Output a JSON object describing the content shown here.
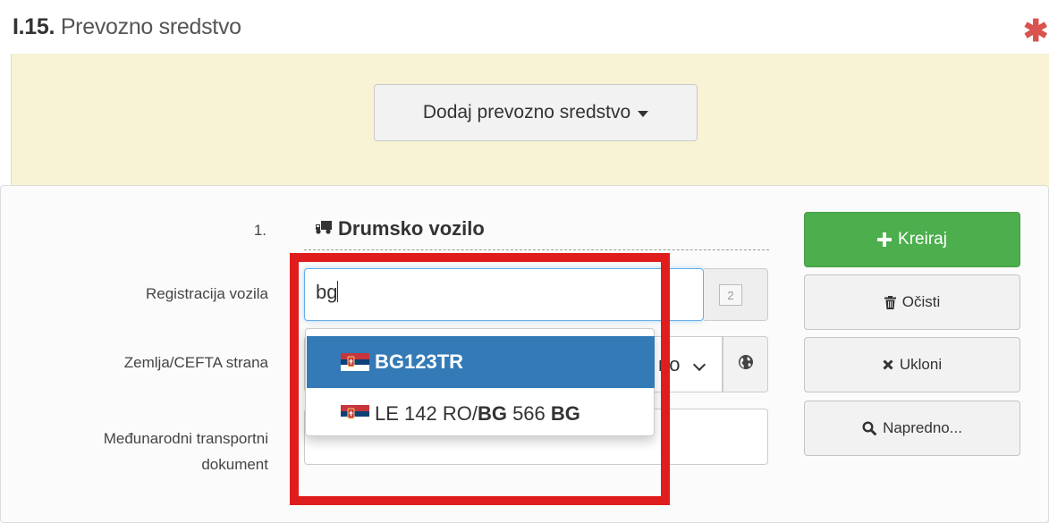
{
  "section": {
    "number": "I.15.",
    "title": "Prevozno sredstvo",
    "required_mark": "✱"
  },
  "add_transport_button": {
    "label": "Dodaj prevozno sredstvo"
  },
  "entry": {
    "index": "1.",
    "vehicle_type": "Drumsko vozilo",
    "registration": {
      "label": "Registracija vozila",
      "value": "bg",
      "count": "2"
    },
    "country": {
      "label": "Zemlja/CEFTA strana",
      "value_fragment": "no"
    },
    "intl_document": {
      "label_line1": "Međunarodni transportni",
      "label_line2": "dokument",
      "value": ""
    }
  },
  "suggestions": [
    {
      "text": "BG123TR",
      "selected": true,
      "flag": "serbia-flag"
    },
    {
      "text_prefix": "LE 142 RO/",
      "text_match": "BG",
      "text_middle": " 566 ",
      "text_suffix": "BG",
      "selected": false,
      "flag": "serbia-flag"
    }
  ],
  "actions": {
    "create": "Kreiraj",
    "clear": "Očisti",
    "remove": "Ukloni",
    "advanced": "Napredno..."
  },
  "colors": {
    "panel_bg": "#f7f3d4",
    "selected_item": "#337ab7",
    "create_btn": "#4cae4c",
    "highlight": "#e01d1d",
    "required": "#d9534f"
  }
}
